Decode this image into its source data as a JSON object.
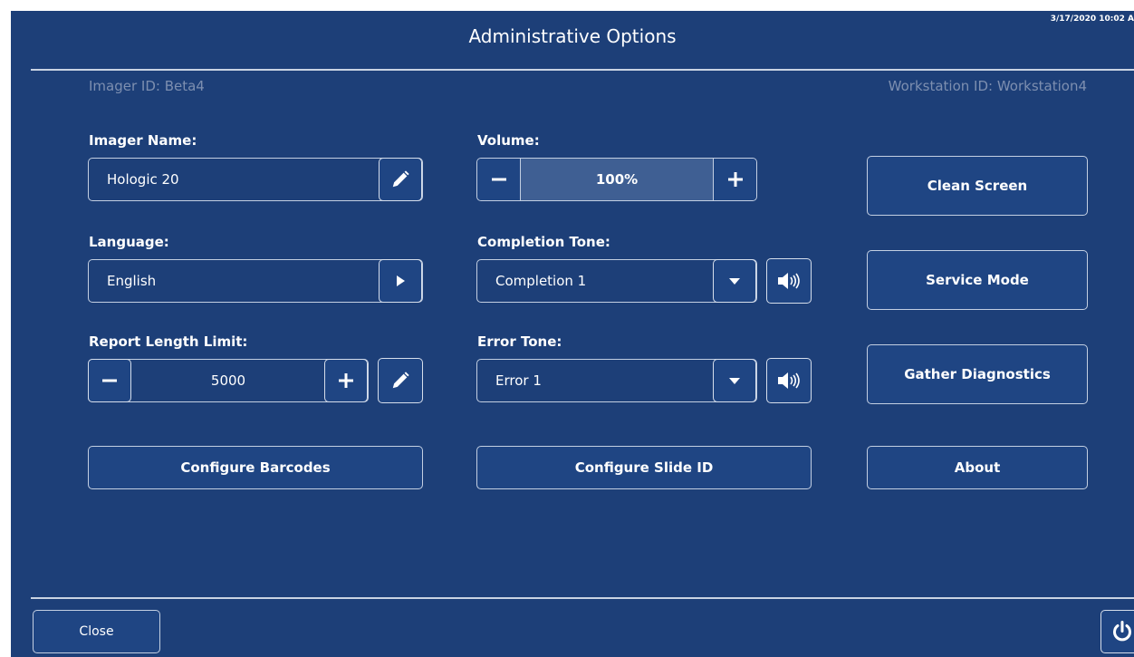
{
  "header": {
    "timestamp": "3/17/2020 10:02 A",
    "title": "Administrative Options"
  },
  "info": {
    "imager_id": "Imager ID: Beta4",
    "workstation_id": "Workstation ID: Workstation4"
  },
  "imager_name": {
    "label": "Imager Name:",
    "value": "Hologic 20"
  },
  "language": {
    "label": "Language:",
    "value": "English"
  },
  "report_length": {
    "label": "Report Length Limit:",
    "value": "5000"
  },
  "volume": {
    "label": "Volume:",
    "value": "100%",
    "level_percent": 100
  },
  "completion_tone": {
    "label": "Completion Tone:",
    "value": "Completion 1"
  },
  "error_tone": {
    "label": "Error Tone:",
    "value": "Error 1"
  },
  "buttons": {
    "configure_barcodes": "Configure Barcodes",
    "configure_slide_id": "Configure Slide ID",
    "clean_screen": "Clean Screen",
    "service_mode": "Service Mode",
    "gather_diagnostics": "Gather Diagnostics",
    "about": "About"
  },
  "footer": {
    "close": "Close"
  },
  "icons": [
    "pencil-icon",
    "play-arrow-icon",
    "minus-icon",
    "plus-icon",
    "dropdown-arrow-icon",
    "speaker-icon",
    "power-icon"
  ],
  "colors": {
    "background": "#1d3f78",
    "button": "#1f4583",
    "border": "#c3cfe2",
    "muted_text": "#7d8fb0",
    "volume_fill": "#3f5f93"
  }
}
